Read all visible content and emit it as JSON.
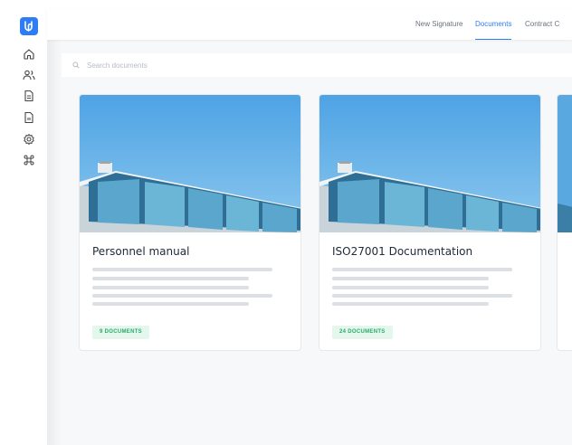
{
  "sidebar": {
    "logo": "logo-icon",
    "items": [
      {
        "icon": "home-icon"
      },
      {
        "icon": "users-icon"
      },
      {
        "icon": "document-icon"
      },
      {
        "icon": "page-icon"
      },
      {
        "icon": "gear-icon"
      },
      {
        "icon": "command-icon"
      }
    ]
  },
  "topbar": {
    "tabs": [
      {
        "label": "New Signature",
        "active": false
      },
      {
        "label": "Documents",
        "active": true
      },
      {
        "label": "Contract C",
        "active": false
      }
    ]
  },
  "search": {
    "placeholder": "Search documents",
    "value": ""
  },
  "cards": [
    {
      "title": "Personnel manual",
      "badge": "9 DOCUMENTS"
    },
    {
      "title": "ISO27001 Documentation",
      "badge": "24 DOCUMENTS"
    }
  ],
  "colors": {
    "accent": "#2e7cf6",
    "badge_text": "#2ea86b",
    "badge_bg": "#e3f7ec",
    "sky": "#5aa8e0"
  }
}
